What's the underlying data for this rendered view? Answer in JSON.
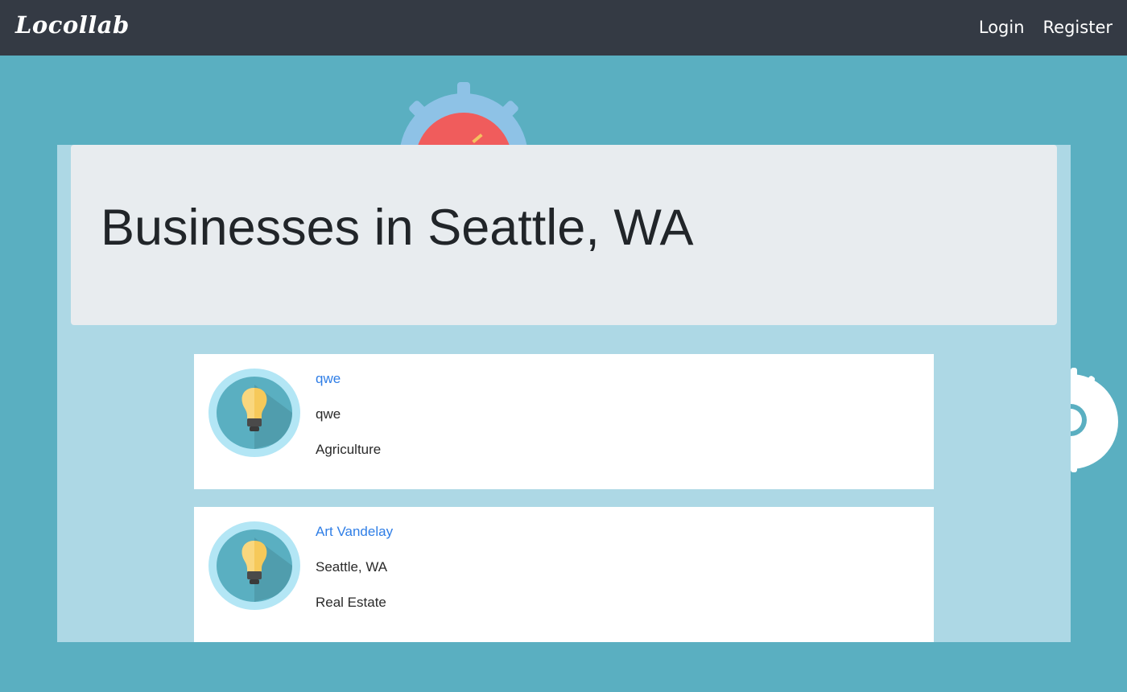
{
  "navbar": {
    "brand": "Locollab",
    "links": [
      "Login",
      "Register"
    ]
  },
  "page": {
    "title": "Businesses in Seattle, WA"
  },
  "businesses": [
    {
      "name": "qwe",
      "location": "qwe",
      "category": "Agriculture"
    },
    {
      "name": "Art Vandelay",
      "location": "Seattle, WA",
      "category": "Real Estate"
    }
  ],
  "icons": {
    "avatar": "lightbulb-icon",
    "background": "gear-icon"
  },
  "colors": {
    "navbar": "#343a44",
    "background": "#5aafc1",
    "panel": "#add8e5",
    "jumbotron": "#e8ecef",
    "link": "#2f7ee6"
  }
}
